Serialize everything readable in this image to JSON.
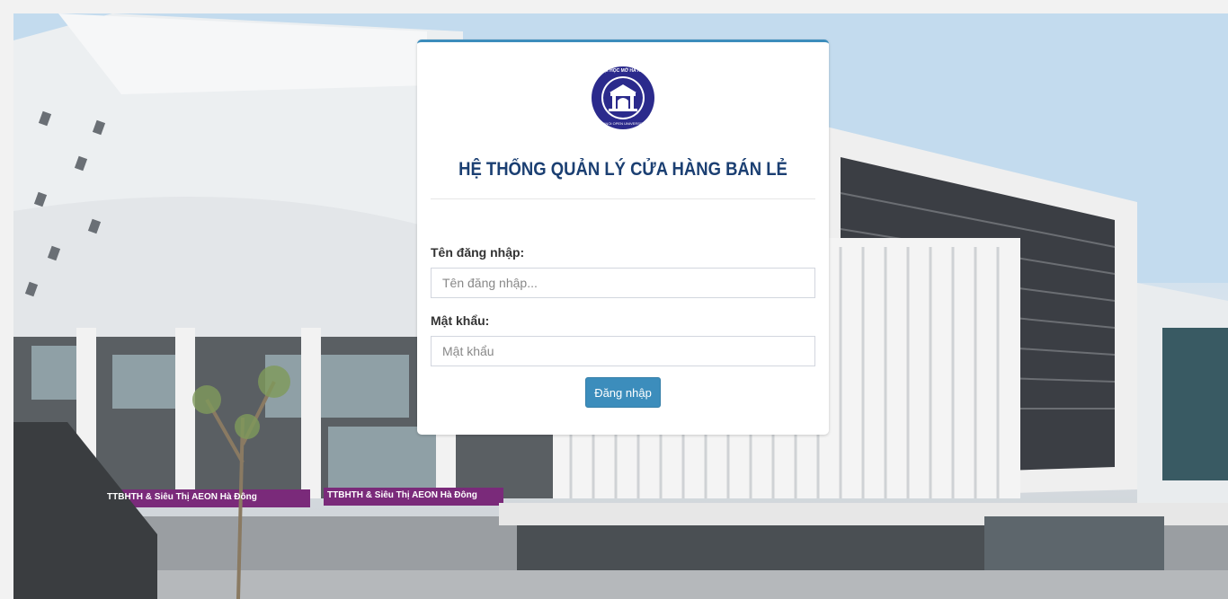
{
  "logo": {
    "icon": "university-seal-icon",
    "ring_top_text": "ĐẠI HỌC MỞ HÀ NỘI",
    "ring_bottom_text": "HANOI OPEN UNIVERSITY",
    "color": "#2b2a8c"
  },
  "login": {
    "title": "HỆ THỐNG QUẢN LÝ CỬA HÀNG BÁN LẺ",
    "username_label": "Tên đăng nhập:",
    "username_placeholder": "Tên đăng nhập...",
    "username_value": "",
    "password_label": "Mật khẩu:",
    "password_placeholder": "Mật khẩu",
    "password_value": "",
    "submit_label": "Đăng nhập"
  },
  "background": {
    "signage_left": "TTBHTH & Siêu Thị AEON Hà Đông",
    "signage_right": "TTBHTH & Siêu Thị AEON Hà Đông"
  },
  "colors": {
    "accent": "#3c8dbc",
    "title": "#1b3f72"
  }
}
